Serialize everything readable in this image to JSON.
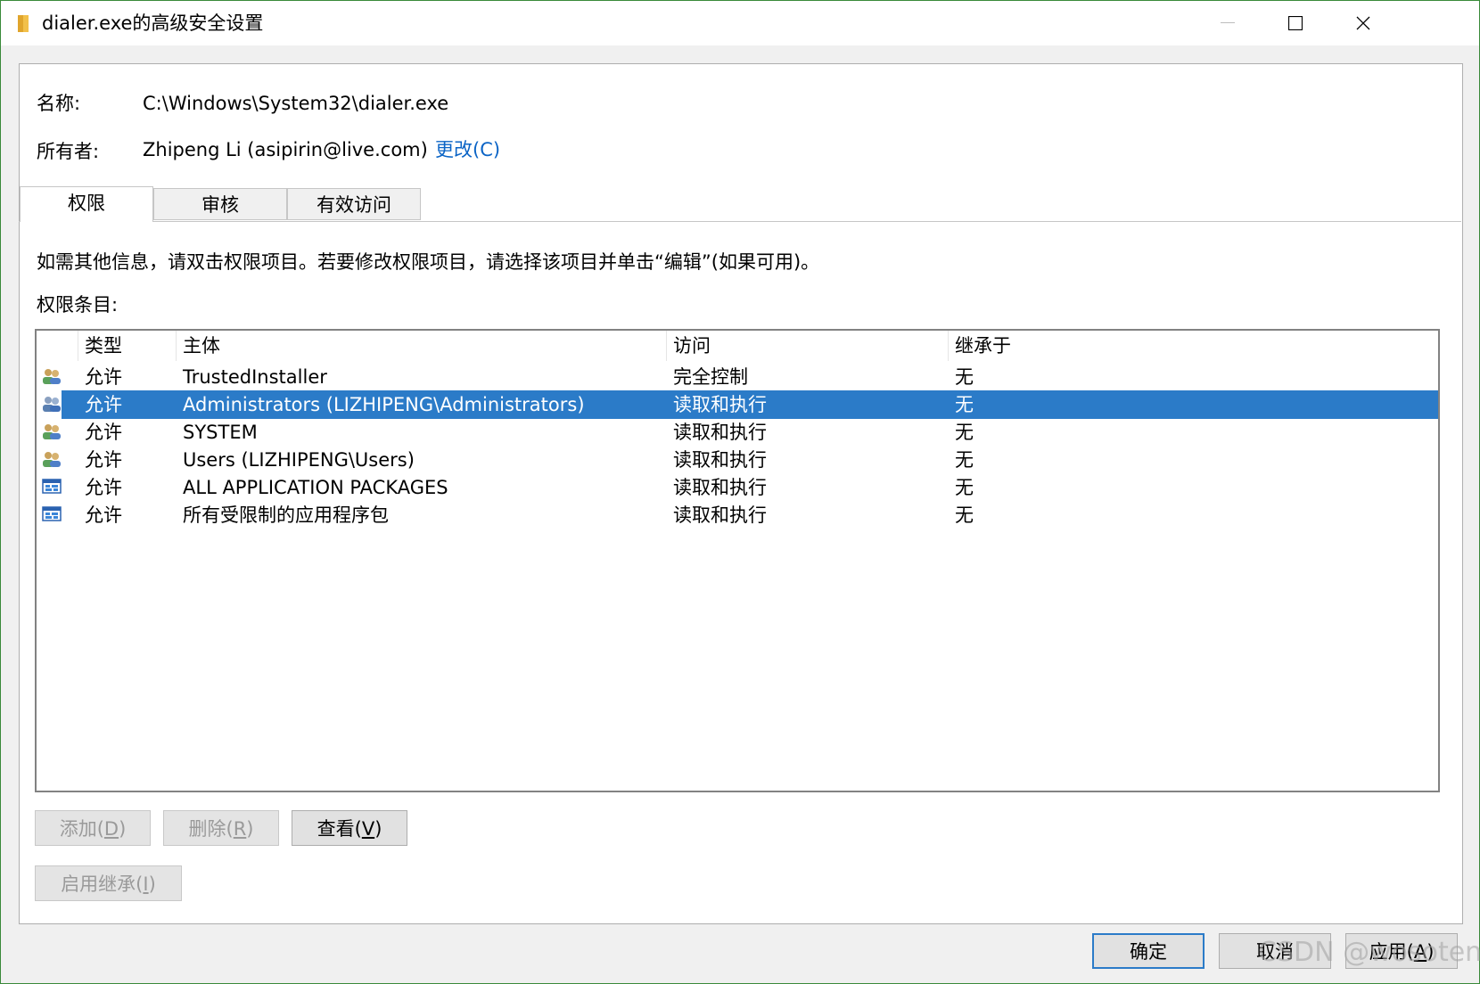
{
  "window": {
    "title": "dialer.exe的高级安全设置",
    "minimize_label": "—",
    "colors": {
      "accent": "#2b7bc8",
      "link": "#0b64c6",
      "selection": "#2b7bc8"
    }
  },
  "info": {
    "name_label": "名称:",
    "name_value": "C:\\Windows\\System32\\dialer.exe",
    "owner_label": "所有者:",
    "owner_value": "Zhipeng Li (asipirin@live.com)",
    "change_link": "更改(C)"
  },
  "tabs": [
    {
      "label": "权限",
      "active": true
    },
    {
      "label": "审核",
      "active": false
    },
    {
      "label": "有效访问",
      "active": false
    }
  ],
  "description": "如需其他信息，请双击权限项目。若要修改权限项目，请选择该项目并单击“编辑”(如果可用)。",
  "entries_label": "权限条目:",
  "columns": [
    "类型",
    "主体",
    "访问",
    "继承于"
  ],
  "rows": [
    {
      "icon": "users-group-icon",
      "type": "允许",
      "principal": "TrustedInstaller",
      "access": "完全控制",
      "inherited": "无",
      "selected": false
    },
    {
      "icon": "users-group-icon",
      "type": "允许",
      "principal": "Administrators (LIZHIPENG\\Administrators)",
      "access": "读取和执行",
      "inherited": "无",
      "selected": true
    },
    {
      "icon": "users-group-icon",
      "type": "允许",
      "principal": "SYSTEM",
      "access": "读取和执行",
      "inherited": "无",
      "selected": false
    },
    {
      "icon": "users-group-icon",
      "type": "允许",
      "principal": "Users (LIZHIPENG\\Users)",
      "access": "读取和执行",
      "inherited": "无",
      "selected": false
    },
    {
      "icon": "app-package-icon",
      "type": "允许",
      "principal": "ALL APPLICATION PACKAGES",
      "access": "读取和执行",
      "inherited": "无",
      "selected": false
    },
    {
      "icon": "app-package-icon",
      "type": "允许",
      "principal": "所有受限制的应用程序包",
      "access": "读取和执行",
      "inherited": "无",
      "selected": false
    }
  ],
  "buttons": {
    "add": {
      "text": "添加(",
      "key": "D",
      "end": ")"
    },
    "remove": {
      "text": "删除(",
      "key": "R",
      "end": ")"
    },
    "view": {
      "text": "查看(",
      "key": "V",
      "end": ")"
    },
    "enable_inheritance": {
      "text": "启用继承(",
      "key": "I",
      "end": ")"
    },
    "ok": "确定",
    "cancel": "取消",
    "apply": {
      "text": "应用(",
      "key": "A",
      "end": ")"
    }
  },
  "watermark": "CSDN @wosoten"
}
